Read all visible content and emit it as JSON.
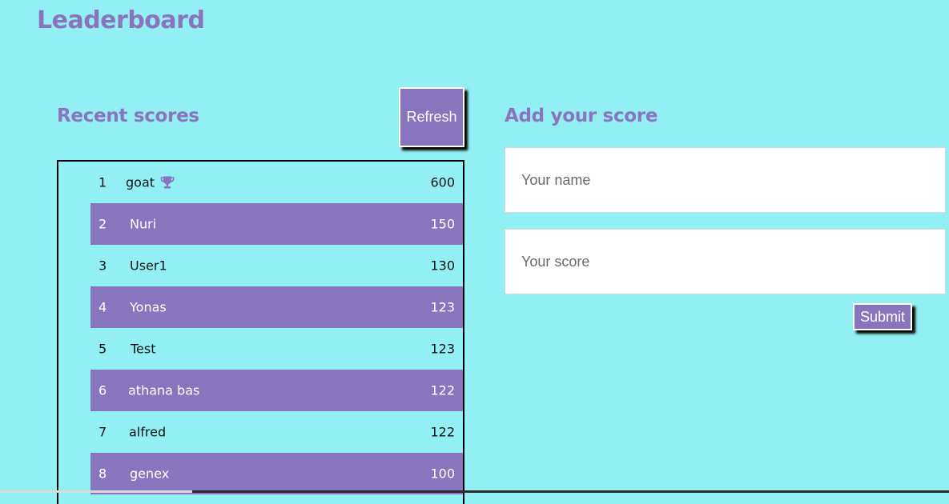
{
  "header": {
    "title": "Leaderboard"
  },
  "recent": {
    "title": "Recent scores",
    "refresh_label": "Refresh",
    "scores": [
      {
        "rank": "1",
        "name": "goat",
        "score": "600",
        "icon": "trophy-icon"
      },
      {
        "rank": "2",
        "name": "Nuri",
        "score": "150"
      },
      {
        "rank": "3",
        "name": "User1",
        "score": "130"
      },
      {
        "rank": "4",
        "name": "Yonas",
        "score": "123"
      },
      {
        "rank": "5",
        "name": "Test",
        "score": "123"
      },
      {
        "rank": "6",
        "name": "athana bas",
        "score": "122"
      },
      {
        "rank": "7",
        "name": "alfred",
        "score": "122"
      },
      {
        "rank": "8",
        "name": "genex",
        "score": "100"
      }
    ]
  },
  "add_score": {
    "title": "Add your score",
    "name_placeholder": "Your name",
    "score_placeholder": "Your score",
    "submit_label": "Submit"
  },
  "colors": {
    "background": "#92EFF3",
    "accent": "#8875BD",
    "heading": "#8A74BE"
  }
}
